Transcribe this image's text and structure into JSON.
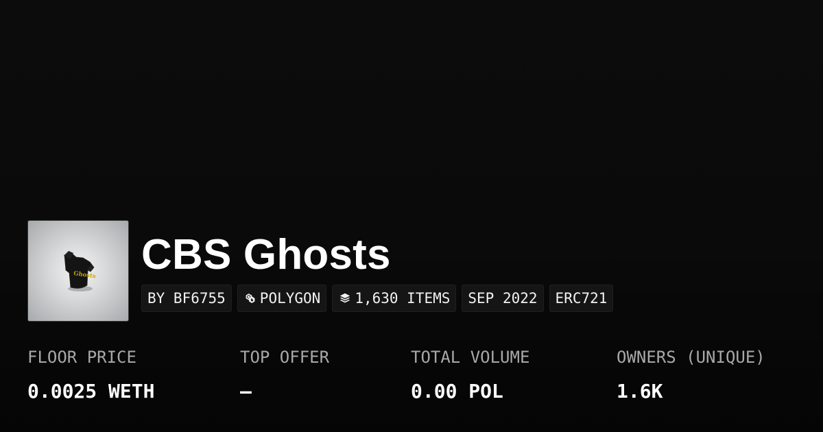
{
  "collection": {
    "title": "CBS Ghosts",
    "thumbnail_icon": "ghost-shirt-nft-image"
  },
  "badges": {
    "creator": "BY BF6755",
    "chain": "POLYGON",
    "chain_icon": "polygon-icon",
    "items": "1,630 ITEMS",
    "items_icon": "layers-icon",
    "created": "SEP 2022",
    "standard": "ERC721"
  },
  "stats": {
    "floor_price": {
      "label": "FLOOR PRICE",
      "value": "0.0025 WETH"
    },
    "top_offer": {
      "label": "TOP OFFER",
      "value": "—"
    },
    "total_volume": {
      "label": "TOTAL VOLUME",
      "value": "0.00 POL"
    },
    "owners": {
      "label": "OWNERS (UNIQUE)",
      "value": "1.6K"
    }
  },
  "colors": {
    "background": "#0b0b0b",
    "badge_background": "#151515",
    "label_gray": "#a8a8a8",
    "text_white": "#ffffff",
    "shirt_print": "#c9a400"
  }
}
